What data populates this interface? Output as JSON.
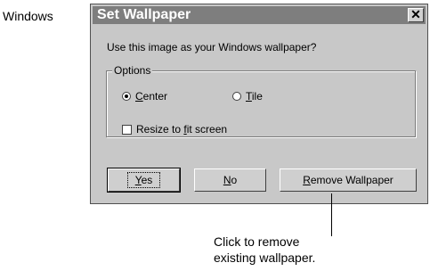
{
  "side_label": "Windows",
  "dialog": {
    "title": "Set Wallpaper",
    "close_glyph": "✕",
    "prompt": "Use this image as your Windows wallpaper?",
    "options_group_label": "Options",
    "radio_center": {
      "pre": "",
      "mnemonic": "C",
      "rest": "enter",
      "selected": true
    },
    "radio_tile": {
      "pre": "",
      "mnemonic": "T",
      "rest": "ile",
      "selected": false
    },
    "resize_checkbox": {
      "pre": "Resize to ",
      "mnemonic": "f",
      "rest": "it screen",
      "checked": false
    },
    "buttons": {
      "yes": {
        "mnemonic": "Y",
        "rest": "es"
      },
      "no": {
        "mnemonic": "N",
        "rest": "o"
      },
      "remove": {
        "mnemonic": "R",
        "rest": "emove Wallpaper"
      }
    }
  },
  "callout": {
    "line1": "Click to remove",
    "line2": "existing wallpaper."
  }
}
